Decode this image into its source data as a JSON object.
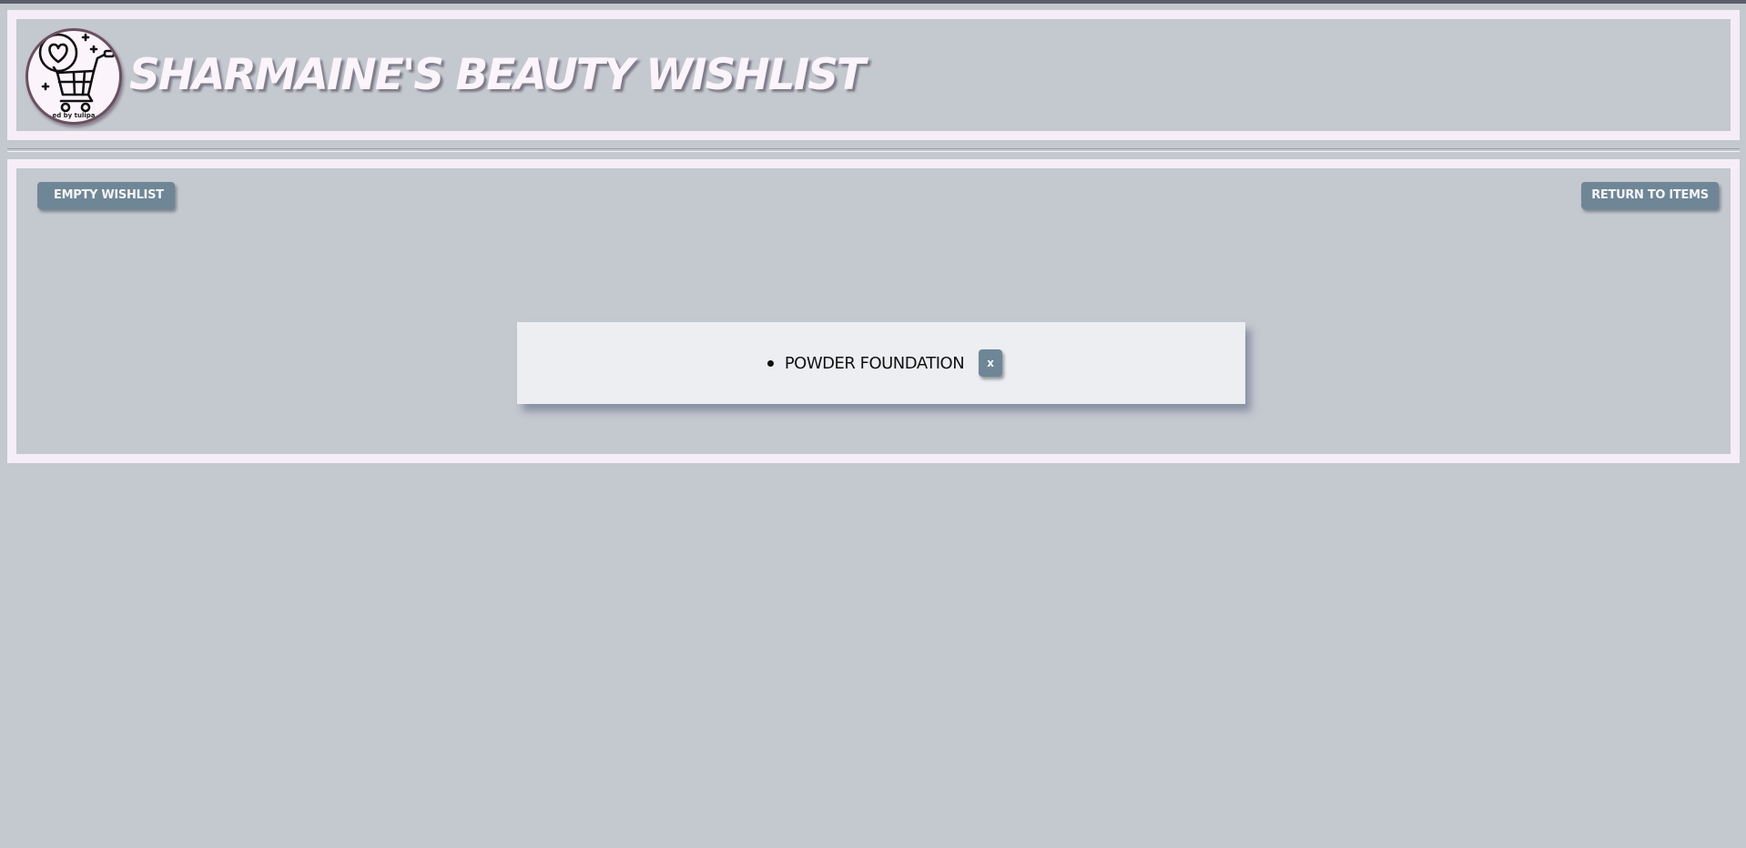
{
  "header": {
    "title": "SHARMAINE'S BEAUTY WISHLIST",
    "logo_icon": "heart-shopping-cart-icon",
    "logo_credit": "ed by tulipa"
  },
  "toolbar": {
    "empty_label": "EMPTY WISHLIST",
    "return_label": "RETURN TO ITEMS"
  },
  "wishlist": {
    "items": [
      {
        "name": "POWDER FOUNDATION",
        "remove_label": "x"
      }
    ]
  },
  "colors": {
    "background": "#c4c8cf",
    "frame": "#f5eef7",
    "button": "#6f8697",
    "card": "#eceef2"
  }
}
